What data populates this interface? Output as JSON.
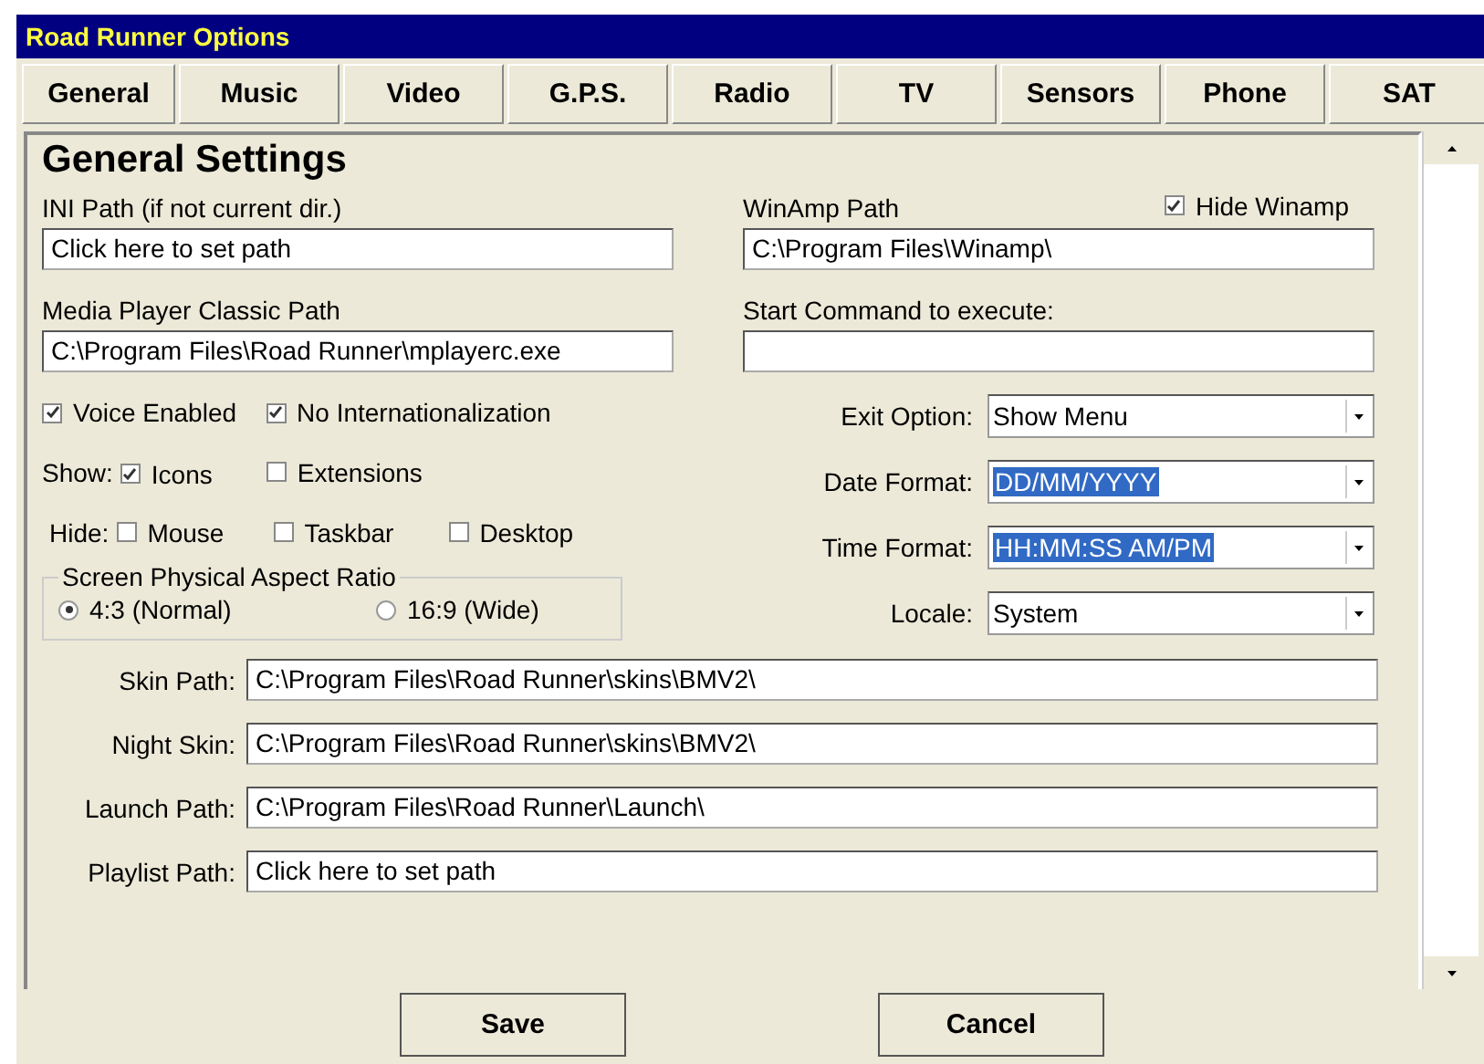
{
  "window": {
    "title": "Road Runner Options"
  },
  "tabs": [
    "General",
    "Music",
    "Video",
    "G.P.S.",
    "Radio",
    "TV",
    "Sensors",
    "Phone",
    "SAT"
  ],
  "heading": "General Settings",
  "ini_path": {
    "label": "INI Path (if not current dir.)",
    "value": "Click here to set path"
  },
  "winamp_path": {
    "label": "WinAmp Path",
    "value": "C:\\Program Files\\Winamp\\"
  },
  "hide_winamp": {
    "label": "Hide Winamp",
    "checked": true
  },
  "mpc_path": {
    "label": "Media Player Classic Path",
    "value": "C:\\Program Files\\Road Runner\\mplayerc.exe"
  },
  "start_command": {
    "label": "Start Command to execute:"
  },
  "options": [
    {
      "label": "Voice Enabled",
      "checked": true
    },
    {
      "label": "No Internationalization",
      "checked": true
    }
  ],
  "show": {
    "label": "Show:",
    "items": [
      {
        "label": "Icons",
        "checked": true
      },
      {
        "label": "Extensions",
        "checked": false
      }
    ]
  },
  "hide": {
    "label": "Hide:",
    "items": [
      {
        "label": "Mouse",
        "checked": false
      },
      {
        "label": "Taskbar",
        "checked": false
      },
      {
        "label": "Desktop",
        "checked": false
      }
    ]
  },
  "aspect_ratio": {
    "title": "Screen Physical Aspect Ratio",
    "choices": [
      {
        "label": "4:3 (Normal)",
        "selected": true
      },
      {
        "label": "16:9 (Wide)",
        "selected": false
      }
    ]
  },
  "dropdowns": [
    {
      "label": "Exit Option:",
      "value": "Show Menu",
      "highlighted": false
    },
    {
      "label": "Date Format:",
      "value": "DD/MM/YYYY",
      "highlighted": true
    },
    {
      "label": "Time Format:",
      "value": "HH:MM:SS AM/PM",
      "highlighted": true
    },
    {
      "label": "Locale:",
      "value": "System",
      "highlighted": false
    }
  ],
  "paths": [
    {
      "label": "Skin Path:",
      "value": "C:\\Program Files\\Road Runner\\skins\\BMV2\\"
    },
    {
      "label": "Night Skin:",
      "value": "C:\\Program Files\\Road Runner\\skins\\BMV2\\"
    },
    {
      "label": "Launch Path:",
      "value": "C:\\Program Files\\Road Runner\\Launch\\"
    },
    {
      "label": "Playlist Path:",
      "value": "Click here to set path"
    }
  ],
  "buttons": [
    "Save",
    "Cancel"
  ]
}
